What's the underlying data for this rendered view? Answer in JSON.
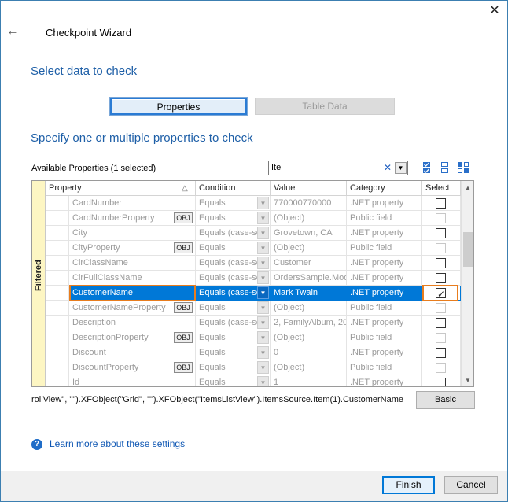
{
  "window": {
    "title": "Checkpoint Wizard",
    "close_glyph": "✕",
    "back_glyph": "←"
  },
  "section1": {
    "heading": "Select data to check"
  },
  "tabs": {
    "properties": "Properties",
    "table_data": "Table Data"
  },
  "section2": {
    "heading": "Specify one or multiple properties to check"
  },
  "available": {
    "label": "Available Properties (1 selected)"
  },
  "filter": {
    "value": "Ite",
    "clear_glyph": "✕",
    "dropdown_glyph": "▼"
  },
  "grid": {
    "side_label": "Filtered",
    "columns": {
      "property": "Property",
      "sort_glyph": "△",
      "condition": "Condition",
      "value": "Value",
      "category": "Category",
      "select": "Select"
    },
    "rows": [
      {
        "property": "CardNumber",
        "obj": "",
        "condition": "Equals",
        "value": "770000770000",
        "category": ".NET property",
        "checkable": true,
        "checked": false
      },
      {
        "property": "CardNumberProperty",
        "obj": "OBJ",
        "condition": "Equals",
        "value": "(Object)",
        "category": "Public field",
        "checkable": false,
        "checked": false
      },
      {
        "property": "City",
        "obj": "",
        "condition": "Equals (case-se",
        "value": "Grovetown, CA",
        "category": ".NET property",
        "checkable": true,
        "checked": false
      },
      {
        "property": "CityProperty",
        "obj": "OBJ",
        "condition": "Equals",
        "value": "(Object)",
        "category": "Public field",
        "checkable": false,
        "checked": false
      },
      {
        "property": "ClrClassName",
        "obj": "",
        "condition": "Equals (case-se",
        "value": "Customer",
        "category": ".NET property",
        "checkable": true,
        "checked": false
      },
      {
        "property": "ClrFullClassName",
        "obj": "",
        "condition": "Equals (case-se",
        "value": "OrdersSample.Mod",
        "category": ".NET property",
        "checkable": true,
        "checked": false
      },
      {
        "property": "CustomerName",
        "obj": "",
        "condition": "Equals (case-se",
        "value": "Mark Twain",
        "category": ".NET property",
        "checkable": true,
        "checked": true,
        "selected": true
      },
      {
        "property": "CustomerNameProperty",
        "obj": "OBJ",
        "condition": "Equals",
        "value": "(Object)",
        "category": "Public field",
        "checkable": false,
        "checked": false
      },
      {
        "property": "Description",
        "obj": "",
        "condition": "Equals (case-se",
        "value": "2, FamilyAlbum, 20",
        "category": ".NET property",
        "checkable": true,
        "checked": false
      },
      {
        "property": "DescriptionProperty",
        "obj": "OBJ",
        "condition": "Equals",
        "value": "(Object)",
        "category": "Public field",
        "checkable": false,
        "checked": false
      },
      {
        "property": "Discount",
        "obj": "",
        "condition": "Equals",
        "value": "0",
        "category": ".NET property",
        "checkable": true,
        "checked": false
      },
      {
        "property": "DiscountProperty",
        "obj": "OBJ",
        "condition": "Equals",
        "value": "(Object)",
        "category": "Public field",
        "checkable": false,
        "checked": false
      },
      {
        "property": "Id",
        "obj": "",
        "condition": "Equals",
        "value": "1",
        "category": ".NET property",
        "checkable": true,
        "checked": false
      }
    ]
  },
  "path": {
    "text": "rollView\", \"\").XFObject(\"Grid\", \"\").XFObject(\"ItemsListView\").ItemsSource.Item(1).CustomerName"
  },
  "basic_button": "Basic",
  "help": {
    "glyph": "?",
    "link": "Learn more about these settings"
  },
  "footer": {
    "finish": "Finish",
    "cancel": "Cancel"
  },
  "colors": {
    "accent": "#0078d7",
    "heading": "#1e5fa7",
    "highlight": "#e87d1e",
    "filtered_strip": "#fdf6c3"
  }
}
